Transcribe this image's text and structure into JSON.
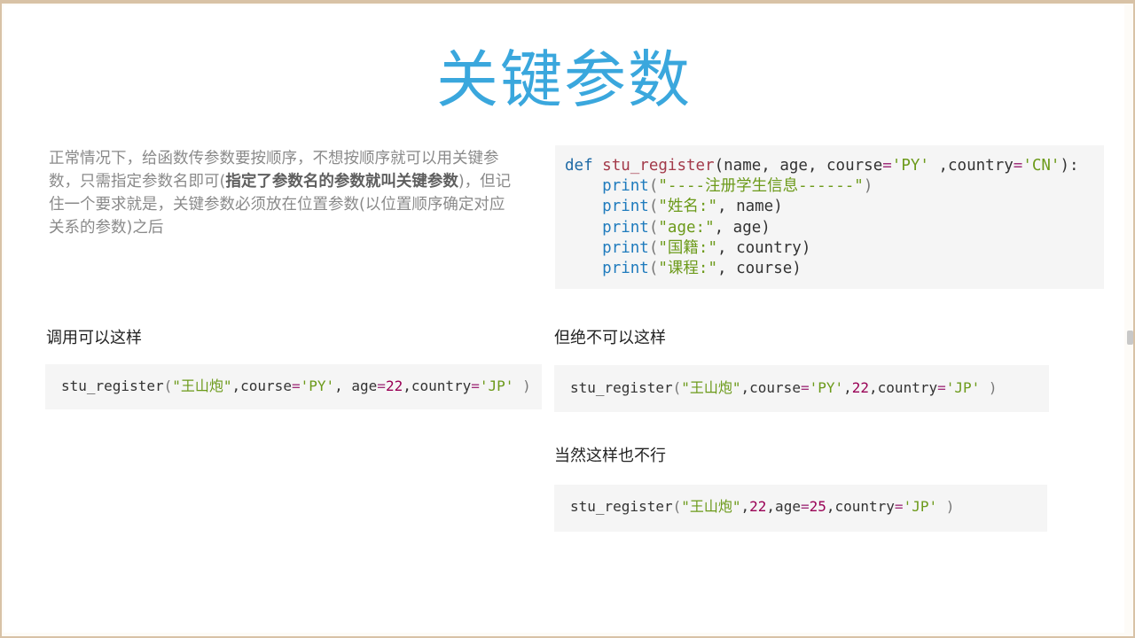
{
  "slide": {
    "title": "关键参数",
    "description_parts": [
      "正常情况下，给函数传参数要按顺序，不想按顺序就可以用关键参数，只需指定参数名即可(",
      "指定了参数名的参数就叫关键参数",
      ")，但记住一个要求就是，关键参数必须放在位置参数(以位置顺序确定对应关系的参数)之后"
    ]
  },
  "code_def": {
    "line1": [
      "def",
      " ",
      "stu_register",
      "(name, age, course",
      "=",
      "'PY'",
      " ,country",
      "=",
      "'CN'",
      "):"
    ],
    "lines": [
      {
        "fn": "print",
        "open": "(",
        "str": "\"----注册学生信息------\"",
        "rest": ")"
      },
      {
        "fn": "print",
        "open": "(",
        "str": "\"姓名:\"",
        "rest": ", name)"
      },
      {
        "fn": "print",
        "open": "(",
        "str": "\"age:\"",
        "rest": ", age)"
      },
      {
        "fn": "print",
        "open": "(",
        "str": "\"国籍:\"",
        "rest": ", country)"
      },
      {
        "fn": "print",
        "open": "(",
        "str": "\"课程:\"",
        "rest": ", course)"
      }
    ]
  },
  "sections": {
    "ok_label": "调用可以这样",
    "not_ok_label": "但绝不可以这样",
    "also_not_ok_label": "当然这样也不行"
  },
  "calls": {
    "ok": [
      "stu_register",
      "(",
      "\"王山炮\"",
      ",course",
      "=",
      "'PY'",
      ", age",
      "=",
      "22",
      ",country",
      "=",
      "'JP'",
      " )"
    ],
    "bad1": [
      "stu_register",
      "(",
      "\"王山炮\"",
      ",course",
      "=",
      "'PY'",
      ",",
      "22",
      ",country",
      "=",
      "'JP'",
      " )"
    ],
    "bad2": [
      "stu_register",
      "(",
      "\"王山炮\"",
      ",",
      "22",
      ",age",
      "=",
      "25",
      ",country",
      "=",
      "'JP'",
      " )"
    ]
  }
}
